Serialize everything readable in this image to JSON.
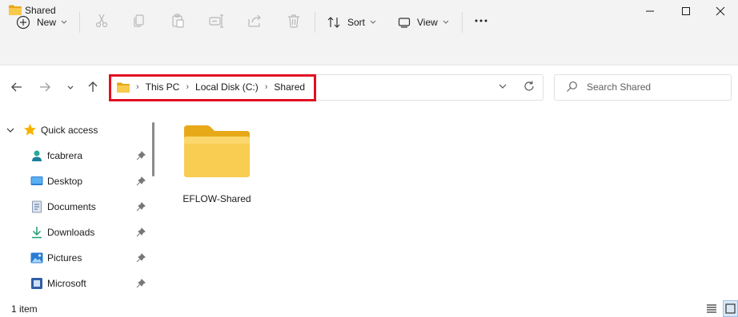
{
  "window": {
    "title": "Shared",
    "minimize_icon": "minimize-icon",
    "maximize_icon": "maximize-icon",
    "close_icon": "close-icon"
  },
  "toolbar": {
    "new_label": "New",
    "sort_label": "Sort",
    "view_label": "View",
    "icons": [
      "plus-circle-icon",
      "cut-icon",
      "copy-icon",
      "paste-icon",
      "rename-icon",
      "share-icon",
      "delete-icon",
      "sort-icon",
      "view-icon",
      "more-icon"
    ]
  },
  "navigation": {
    "icons": [
      "back-arrow-icon",
      "forward-arrow-icon",
      "recent-chevron-icon",
      "up-arrow-icon"
    ]
  },
  "address_bar": {
    "crumbs": [
      "This PC",
      "Local Disk (C:)",
      "Shared"
    ],
    "separator": "›",
    "highlight_color": "#e01020"
  },
  "search": {
    "placeholder": "Search Shared"
  },
  "sidebar": {
    "quick_access_label": "Quick access",
    "items": [
      {
        "label": "fcabrera",
        "icon": "user-icon",
        "pinned": true
      },
      {
        "label": "Desktop",
        "icon": "desktop-icon",
        "pinned": true
      },
      {
        "label": "Documents",
        "icon": "documents-icon",
        "pinned": true
      },
      {
        "label": "Downloads",
        "icon": "downloads-icon",
        "pinned": true
      },
      {
        "label": "Pictures",
        "icon": "pictures-icon",
        "pinned": true
      },
      {
        "label": "Microsoft",
        "icon": "microsoft-icon",
        "pinned": true
      }
    ]
  },
  "content": {
    "items": [
      {
        "name": "EFLOW-Shared",
        "icon": "folder-icon"
      }
    ]
  },
  "status": {
    "item_count": "1 item"
  },
  "colors": {
    "folder_yellow": "#f8c94b",
    "accent_blue": "#0067c0",
    "chrome_bg": "#f3f3f3"
  }
}
